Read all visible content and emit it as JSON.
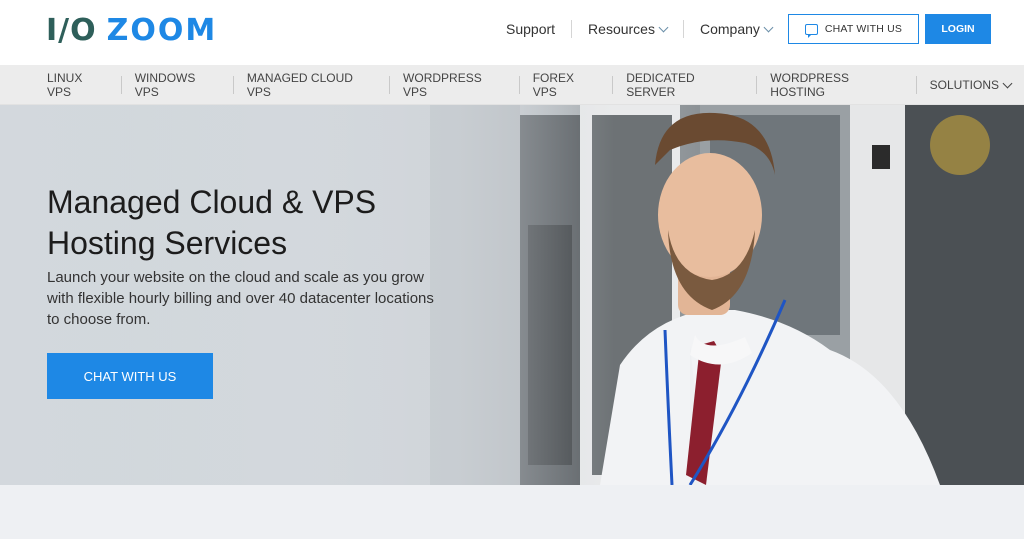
{
  "brand": {
    "logo_left": "I/O",
    "logo_right": "ZOOM",
    "color_dark": "#2e5f5a",
    "color_accent": "#1e88e5"
  },
  "topnav": {
    "support": "Support",
    "resources": "Resources",
    "company": "Company",
    "chat_label": "CHAT WITH US",
    "chat_icon": "chat-bubble-icon",
    "login_label": "LOGIN"
  },
  "subnav": {
    "items": [
      "LINUX VPS",
      "WINDOWS VPS",
      "MANAGED CLOUD VPS",
      "WORDPRESS VPS",
      "FOREX VPS",
      "DEDICATED SERVER",
      "WORDPRESS HOSTING",
      "SOLUTIONS"
    ]
  },
  "hero": {
    "title_line1": "Managed Cloud & VPS",
    "title_line2": "Hosting Services",
    "subtitle": "Launch your website on the cloud and scale as you grow with flexible hourly billing and over 40 datacenter locations to choose from.",
    "cta": "CHAT WITH US"
  }
}
